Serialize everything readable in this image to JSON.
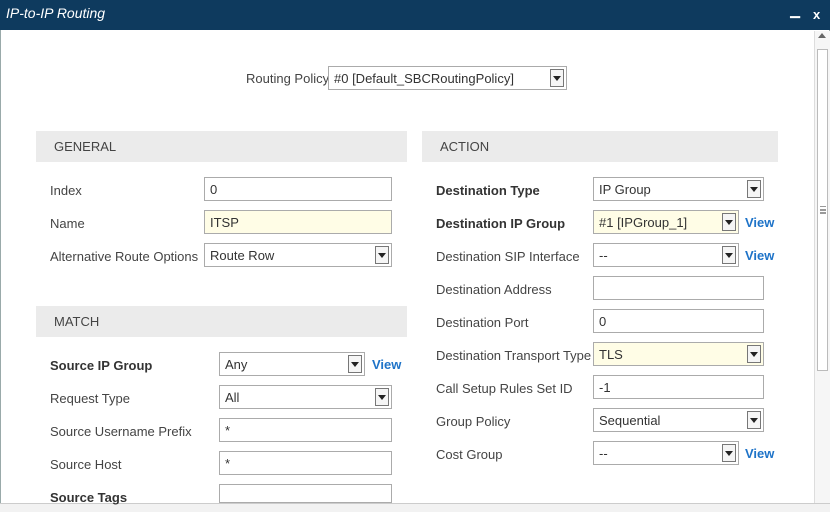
{
  "window": {
    "title": "IP-to-IP Routing",
    "minimize": "▁",
    "close": "x"
  },
  "routing_policy": {
    "label": "Routing Policy",
    "value": "#0 [Default_SBCRoutingPolicy]"
  },
  "general": {
    "heading": "GENERAL",
    "index": {
      "label": "Index",
      "value": "0"
    },
    "name": {
      "label": "Name",
      "value": "ITSP"
    },
    "alt_route": {
      "label": "Alternative Route Options",
      "value": "Route Row"
    }
  },
  "match": {
    "heading": "MATCH",
    "source_ip_group": {
      "label": "Source IP Group",
      "value": "Any",
      "link": "View"
    },
    "request_type": {
      "label": "Request Type",
      "value": "All"
    },
    "source_username_prefix": {
      "label": "Source Username Prefix",
      "value": "*"
    },
    "source_host": {
      "label": "Source Host",
      "value": "*"
    },
    "source_tags": {
      "label": "Source Tags",
      "value": ""
    }
  },
  "action": {
    "heading": "ACTION",
    "dest_type": {
      "label": "Destination Type",
      "value": "IP Group"
    },
    "dest_ip_group": {
      "label": "Destination IP Group",
      "value": "#1 [IPGroup_1]",
      "link": "View"
    },
    "dest_sip_interface": {
      "label": "Destination SIP Interface",
      "value": "--",
      "link": "View"
    },
    "dest_address": {
      "label": "Destination Address",
      "value": ""
    },
    "dest_port": {
      "label": "Destination Port",
      "value": "0"
    },
    "dest_transport": {
      "label": "Destination Transport Type",
      "value": "TLS"
    },
    "call_setup_rules": {
      "label": "Call Setup Rules Set ID",
      "value": "-1"
    },
    "group_policy": {
      "label": "Group Policy",
      "value": "Sequential"
    },
    "cost_group": {
      "label": "Cost Group",
      "value": "--",
      "link": "View"
    }
  }
}
